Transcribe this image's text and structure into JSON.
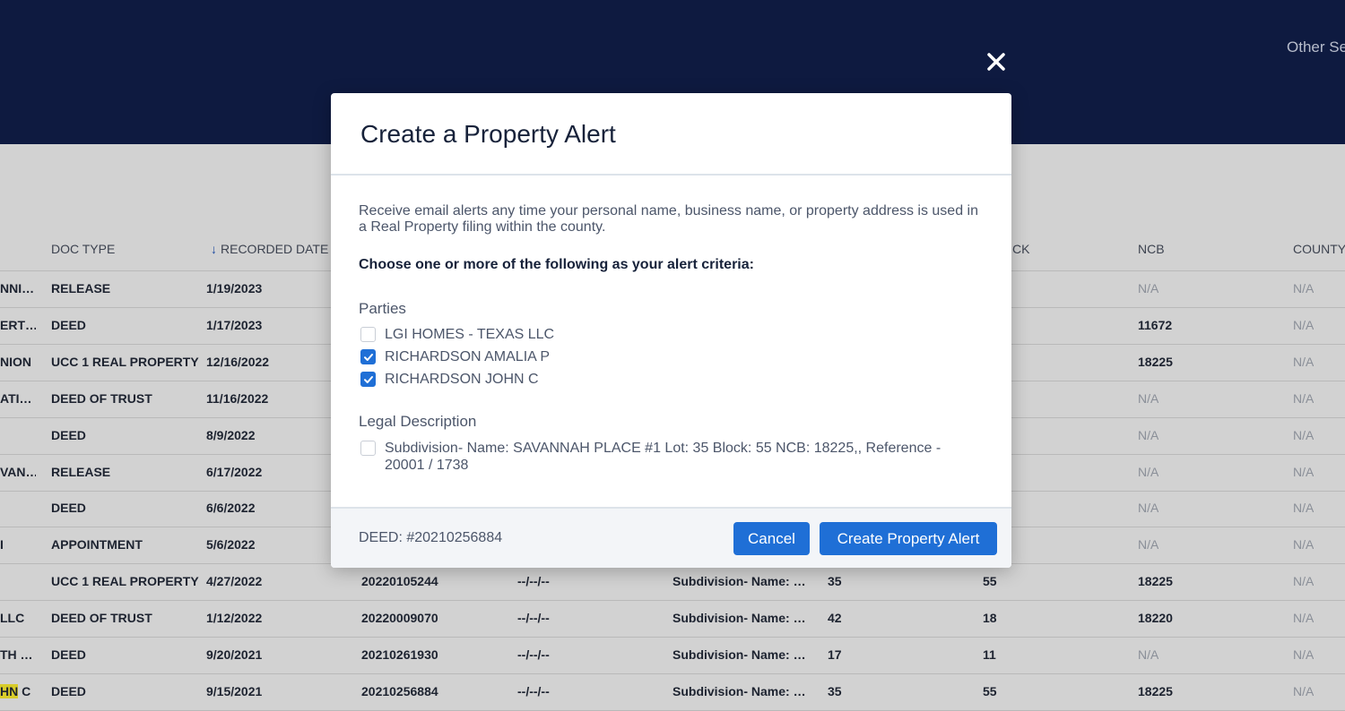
{
  "header": {
    "other_link": "Other Se"
  },
  "table": {
    "columns": [
      "DOC TYPE",
      "RECORDED DATE",
      "CK",
      "NCB",
      "COUNTY"
    ],
    "rows": [
      {
        "name": "NNI…",
        "doc_type": "RELEASE",
        "date": "1/19/2023",
        "ncb": "N/A",
        "county": "N/A"
      },
      {
        "name": "ERT…",
        "doc_type": "DEED",
        "date": "1/17/2023",
        "ncb": "11672",
        "county": "N/A"
      },
      {
        "name": "NION",
        "doc_type": "UCC 1 REAL PROPERTY",
        "date": "12/16/2022",
        "ncb": "18225",
        "county": "N/A"
      },
      {
        "name": "ATI…",
        "doc_type": "DEED OF TRUST",
        "date": "11/16/2022",
        "ncb": "N/A",
        "county": "N/A"
      },
      {
        "name": "",
        "doc_type": "DEED",
        "date": "8/9/2022",
        "ncb": "N/A",
        "county": "N/A"
      },
      {
        "name": "VAN…",
        "doc_type": "RELEASE",
        "date": "6/17/2022",
        "ncb": "N/A",
        "county": "N/A"
      },
      {
        "name": "",
        "doc_type": "DEED",
        "date": "6/6/2022",
        "ncb": "N/A",
        "county": "N/A"
      },
      {
        "name": "I",
        "doc_type": "APPOINTMENT",
        "date": "5/6/2022",
        "ncb": "N/A",
        "county": "N/A"
      },
      {
        "name": "",
        "doc_type": "UCC 1 REAL PROPERTY",
        "date": "4/27/2022",
        "doc_no": "20220105244",
        "other_date": "--/--/--",
        "legal": "Subdivision- Name: …",
        "lot": "35",
        "block": "55",
        "ncb": "18225",
        "county": "N/A"
      },
      {
        "name": "LLC",
        "doc_type": "DEED OF TRUST",
        "date": "1/12/2022",
        "doc_no": "20220009070",
        "other_date": "--/--/--",
        "legal": "Subdivision- Name: …",
        "lot": "42",
        "block": "18",
        "ncb": "18220",
        "county": "N/A"
      },
      {
        "name": "TH …",
        "doc_type": "DEED",
        "date": "9/20/2021",
        "doc_no": "20210261930",
        "other_date": "--/--/--",
        "legal": "Subdivision- Name: …",
        "lot": "17",
        "block": "11",
        "ncb": "N/A",
        "county": "N/A"
      },
      {
        "name": "HN C",
        "doc_type": "DEED",
        "date": "9/15/2021",
        "doc_no": "20210256884",
        "other_date": "--/--/--",
        "legal": "Subdivision- Name: …",
        "lot": "35",
        "block": "55",
        "ncb": "18225",
        "county": "N/A"
      }
    ]
  },
  "modal": {
    "title": "Create a Property Alert",
    "intro": "Receive email alerts any time your personal name, business name, or property address is used in a Real Property filing within the county.",
    "criteria": "Choose one or more of the following as your alert criteria:",
    "parties_label": "Parties",
    "parties": [
      {
        "label": "LGI HOMES - TEXAS LLC",
        "checked": false
      },
      {
        "label": "RICHARDSON AMALIA P",
        "checked": true
      },
      {
        "label": "RICHARDSON JOHN C",
        "checked": true
      }
    ],
    "legal_label": "Legal Description",
    "legal": {
      "label": "Subdivision- Name: SAVANNAH PLACE #1 Lot: 35 Block: 55 NCB: 18225,, Reference - 20001 / 1738",
      "checked": false
    },
    "footer_ref": "DEED: #20210256884",
    "cancel_label": "Cancel",
    "create_label": "Create Property Alert"
  },
  "colors": {
    "primary": "#1f6fd6",
    "header_bg": "#0e1a40",
    "highlight": "#d8cc2a"
  }
}
